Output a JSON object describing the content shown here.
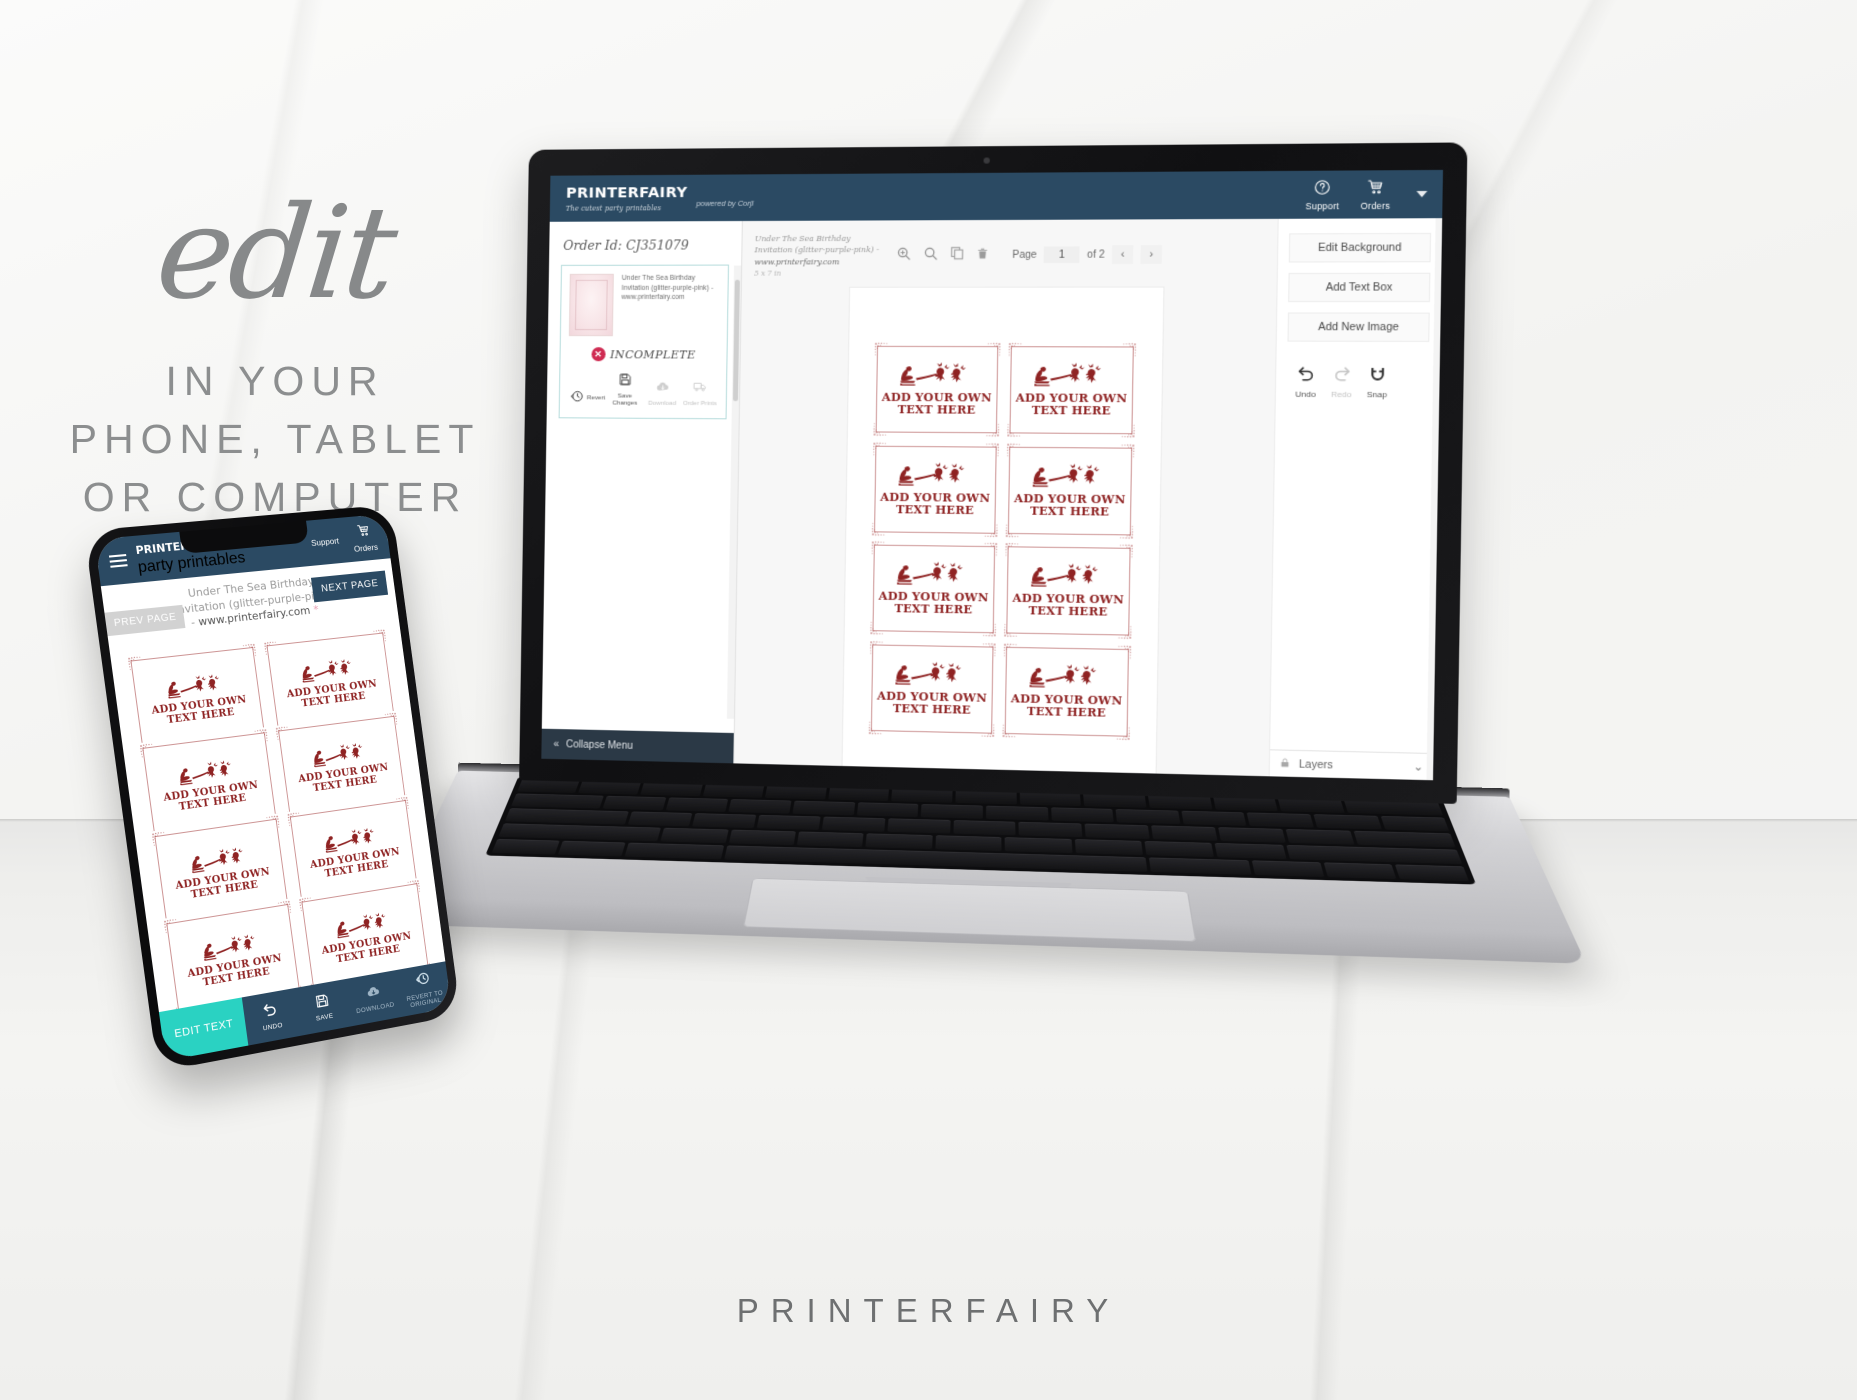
{
  "headline": {
    "script_word": "edit",
    "line1": "IN YOUR",
    "line2": "PHONE, TABLET",
    "line3": "OR COMPUTER"
  },
  "footer_brand": "PRINTERFAIRY",
  "app": {
    "topbar": {
      "logo": "PRINTERFAIRY",
      "logo_tagline": "The cutest party printables",
      "powered_by": "powered by Corjl",
      "support_label": "Support",
      "support_icon": "question-circle-icon",
      "orders_label": "Orders",
      "orders_icon": "shopping-cart-icon",
      "dropdown_icon": "caret-down-icon",
      "bg_color": "#2b4a63"
    },
    "sidebar": {
      "order_id_label": "Order Id: CJ351079",
      "product_title": "Under The Sea Birthday Invitation (glitter-purple-pink) - www.printerfairy.com",
      "status_badge": "INCOMPLETE",
      "status_color": "#cf2b52",
      "actions": [
        {
          "label": "Revert",
          "icon": "revert-clock-icon",
          "enabled": true
        },
        {
          "label": "Save Changes",
          "icon": "floppy-disk-icon",
          "enabled": true
        },
        {
          "label": "Download",
          "icon": "cloud-download-icon",
          "enabled": false
        },
        {
          "label": "Order Prints",
          "icon": "delivery-truck-icon",
          "enabled": false
        }
      ],
      "collapse_label": "Collapse Menu",
      "collapse_icon": "double-chevron-left-icon"
    },
    "canvas": {
      "doc_title_muted": "Under The Sea Birthday Invitation (glitter-purple-pink) -",
      "doc_title_strong": "www.printerfairy.com",
      "doc_size": "5 x 7 in",
      "tools": [
        {
          "name": "zoom-in-icon"
        },
        {
          "name": "zoom-out-icon"
        },
        {
          "name": "duplicate-icon"
        },
        {
          "name": "trash-icon"
        }
      ],
      "page_label": "Page",
      "page_value": "1",
      "page_total": "of 2",
      "prev_icon": "chevron-left-icon",
      "next_icon": "chevron-right-icon",
      "card_text_line1": "ADD YOUR OWN",
      "card_text_line2": "TEXT HERE",
      "card_color": "#8f2323",
      "card_count": 8
    },
    "right_panel": {
      "buttons": [
        {
          "label": "Edit Background"
        },
        {
          "label": "Add Text Box"
        },
        {
          "label": "Add New Image"
        }
      ],
      "history": [
        {
          "label": "Undo",
          "icon": "undo-arrow-icon",
          "enabled": true
        },
        {
          "label": "Redo",
          "icon": "redo-arrow-icon",
          "enabled": false
        },
        {
          "label": "Snap",
          "icon": "magnet-icon",
          "enabled": true
        }
      ],
      "layers_label": "Layers",
      "layers_lock_icon": "lock-icon",
      "layers_chevron_icon": "chevron-down-icon"
    }
  },
  "phone": {
    "topbar": {
      "menu_icon": "hamburger-menu-icon",
      "logo": "PRINTERFAIRY",
      "logo_tagline": "The cutest party printables",
      "support_label": "Support",
      "orders_label": "Orders"
    },
    "product_title_muted": "Under The Sea Birthday Invitation (glitter-purple-pink) -",
    "product_title_strong": "www.printerfairy.com",
    "product_title_star": "*",
    "prev_page_label": "PREV PAGE",
    "next_page_label": "NEXT PAGE",
    "card_text_line1": "ADD YOUR OWN",
    "card_text_line2": "TEXT HERE",
    "card_count": 8,
    "bottom_bar": {
      "edit_text_label": "EDIT TEXT",
      "edit_text_color": "#2ad2c2",
      "items": [
        {
          "label": "UNDO",
          "icon": "undo-arrow-icon",
          "faded": false
        },
        {
          "label": "SAVE",
          "icon": "floppy-disk-icon",
          "faded": false
        },
        {
          "label": "DOWNLOAD",
          "icon": "cloud-download-icon",
          "faded": true
        },
        {
          "label": "REVERT TO ORIGINAL",
          "icon": "revert-clock-icon",
          "faded": true
        }
      ]
    }
  }
}
